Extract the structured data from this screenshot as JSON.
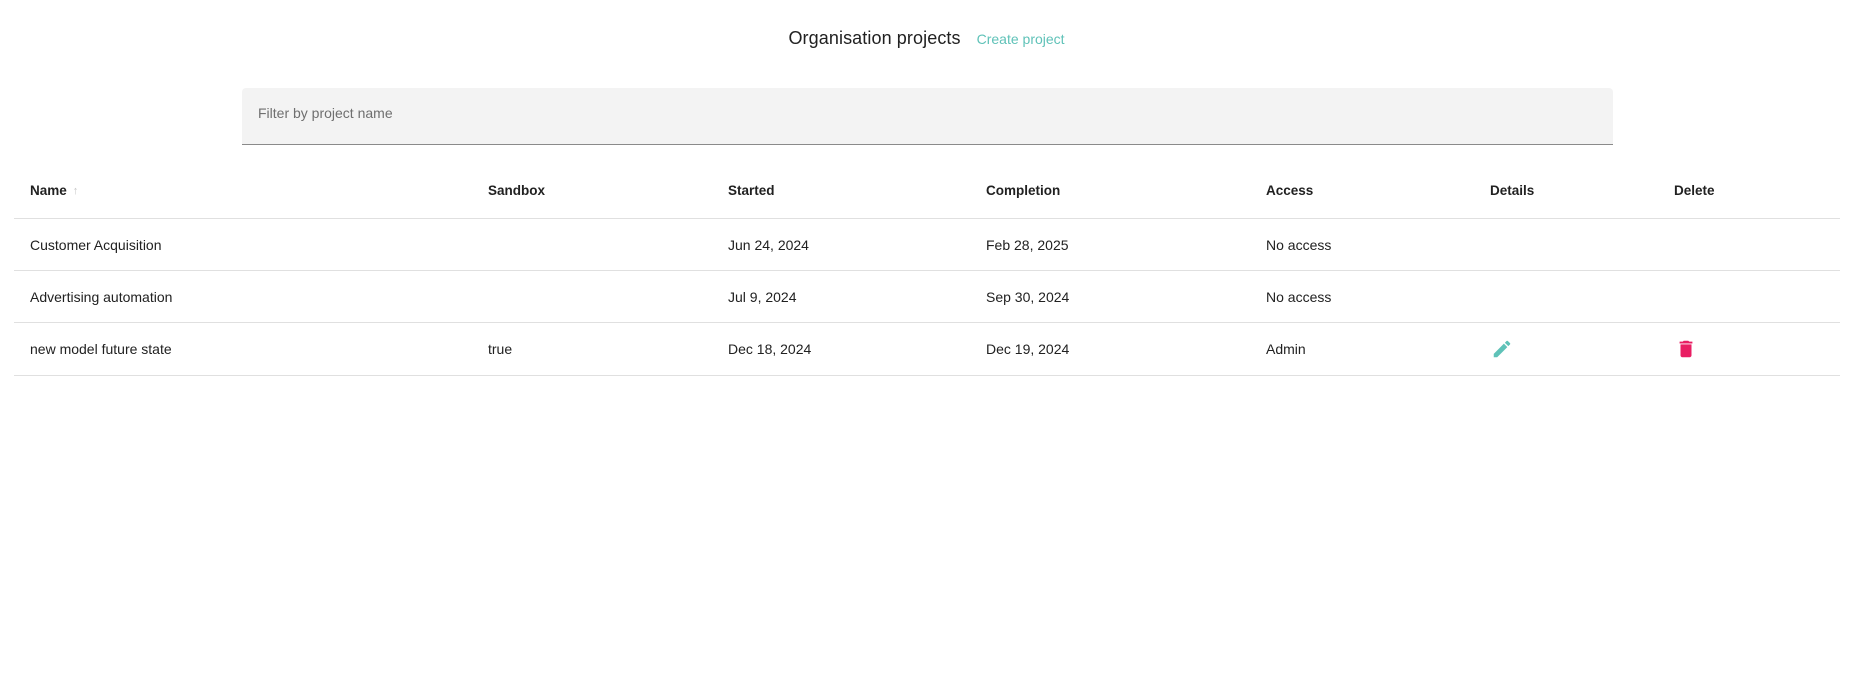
{
  "header": {
    "title": "Organisation projects",
    "create_label": "Create project"
  },
  "filter": {
    "placeholder": "Filter by project name",
    "value": ""
  },
  "table": {
    "columns": {
      "name": "Name",
      "sandbox": "Sandbox",
      "started": "Started",
      "completion": "Completion",
      "access": "Access",
      "details": "Details",
      "delete": "Delete"
    },
    "sort": {
      "column": "name",
      "direction": "asc",
      "icon": "arrow-up-icon"
    },
    "rows": [
      {
        "name": "Customer Acquisition",
        "sandbox": "",
        "started": "Jun 24, 2024",
        "completion": "Feb 28, 2025",
        "access": "No access",
        "details_icon": "",
        "delete_icon": ""
      },
      {
        "name": "Advertising automation",
        "sandbox": "",
        "started": "Jul 9, 2024",
        "completion": "Sep 30, 2024",
        "access": "No access",
        "details_icon": "",
        "delete_icon": ""
      },
      {
        "name": "new model future state",
        "sandbox": "true",
        "started": "Dec 18, 2024",
        "completion": "Dec 19, 2024",
        "access": "Admin",
        "details_icon": "pencil-icon",
        "delete_icon": "trash-icon"
      }
    ]
  },
  "colors": {
    "accent": "#5fc2b8",
    "danger": "#e91e63",
    "filter_bg": "#f3f3f3",
    "divider": "#e0e0e0"
  }
}
